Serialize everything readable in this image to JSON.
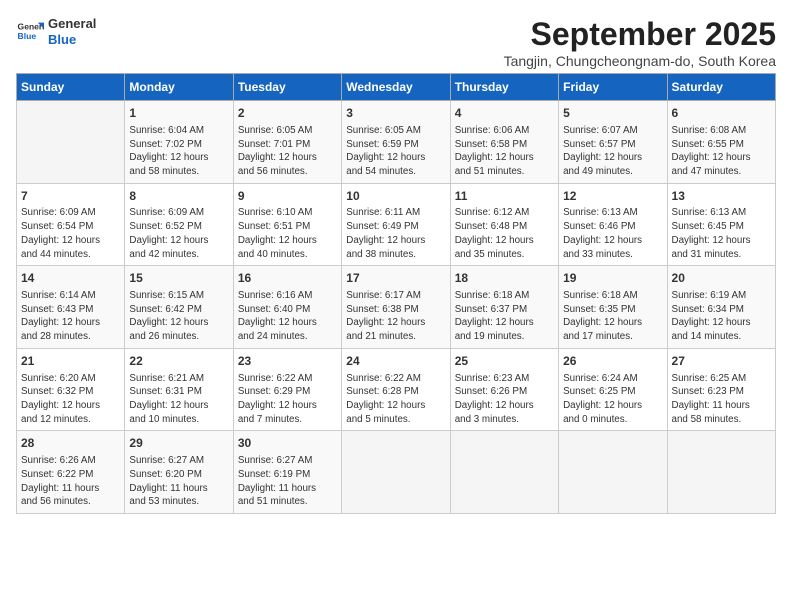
{
  "logo": {
    "line1": "General",
    "line2": "Blue"
  },
  "title": "September 2025",
  "location": "Tangjin, Chungcheongnam-do, South Korea",
  "weekdays": [
    "Sunday",
    "Monday",
    "Tuesday",
    "Wednesday",
    "Thursday",
    "Friday",
    "Saturday"
  ],
  "weeks": [
    [
      {
        "day": "",
        "text": ""
      },
      {
        "day": "1",
        "text": "Sunrise: 6:04 AM\nSunset: 7:02 PM\nDaylight: 12 hours\nand 58 minutes."
      },
      {
        "day": "2",
        "text": "Sunrise: 6:05 AM\nSunset: 7:01 PM\nDaylight: 12 hours\nand 56 minutes."
      },
      {
        "day": "3",
        "text": "Sunrise: 6:05 AM\nSunset: 6:59 PM\nDaylight: 12 hours\nand 54 minutes."
      },
      {
        "day": "4",
        "text": "Sunrise: 6:06 AM\nSunset: 6:58 PM\nDaylight: 12 hours\nand 51 minutes."
      },
      {
        "day": "5",
        "text": "Sunrise: 6:07 AM\nSunset: 6:57 PM\nDaylight: 12 hours\nand 49 minutes."
      },
      {
        "day": "6",
        "text": "Sunrise: 6:08 AM\nSunset: 6:55 PM\nDaylight: 12 hours\nand 47 minutes."
      }
    ],
    [
      {
        "day": "7",
        "text": "Sunrise: 6:09 AM\nSunset: 6:54 PM\nDaylight: 12 hours\nand 44 minutes."
      },
      {
        "day": "8",
        "text": "Sunrise: 6:09 AM\nSunset: 6:52 PM\nDaylight: 12 hours\nand 42 minutes."
      },
      {
        "day": "9",
        "text": "Sunrise: 6:10 AM\nSunset: 6:51 PM\nDaylight: 12 hours\nand 40 minutes."
      },
      {
        "day": "10",
        "text": "Sunrise: 6:11 AM\nSunset: 6:49 PM\nDaylight: 12 hours\nand 38 minutes."
      },
      {
        "day": "11",
        "text": "Sunrise: 6:12 AM\nSunset: 6:48 PM\nDaylight: 12 hours\nand 35 minutes."
      },
      {
        "day": "12",
        "text": "Sunrise: 6:13 AM\nSunset: 6:46 PM\nDaylight: 12 hours\nand 33 minutes."
      },
      {
        "day": "13",
        "text": "Sunrise: 6:13 AM\nSunset: 6:45 PM\nDaylight: 12 hours\nand 31 minutes."
      }
    ],
    [
      {
        "day": "14",
        "text": "Sunrise: 6:14 AM\nSunset: 6:43 PM\nDaylight: 12 hours\nand 28 minutes."
      },
      {
        "day": "15",
        "text": "Sunrise: 6:15 AM\nSunset: 6:42 PM\nDaylight: 12 hours\nand 26 minutes."
      },
      {
        "day": "16",
        "text": "Sunrise: 6:16 AM\nSunset: 6:40 PM\nDaylight: 12 hours\nand 24 minutes."
      },
      {
        "day": "17",
        "text": "Sunrise: 6:17 AM\nSunset: 6:38 PM\nDaylight: 12 hours\nand 21 minutes."
      },
      {
        "day": "18",
        "text": "Sunrise: 6:18 AM\nSunset: 6:37 PM\nDaylight: 12 hours\nand 19 minutes."
      },
      {
        "day": "19",
        "text": "Sunrise: 6:18 AM\nSunset: 6:35 PM\nDaylight: 12 hours\nand 17 minutes."
      },
      {
        "day": "20",
        "text": "Sunrise: 6:19 AM\nSunset: 6:34 PM\nDaylight: 12 hours\nand 14 minutes."
      }
    ],
    [
      {
        "day": "21",
        "text": "Sunrise: 6:20 AM\nSunset: 6:32 PM\nDaylight: 12 hours\nand 12 minutes."
      },
      {
        "day": "22",
        "text": "Sunrise: 6:21 AM\nSunset: 6:31 PM\nDaylight: 12 hours\nand 10 minutes."
      },
      {
        "day": "23",
        "text": "Sunrise: 6:22 AM\nSunset: 6:29 PM\nDaylight: 12 hours\nand 7 minutes."
      },
      {
        "day": "24",
        "text": "Sunrise: 6:22 AM\nSunset: 6:28 PM\nDaylight: 12 hours\nand 5 minutes."
      },
      {
        "day": "25",
        "text": "Sunrise: 6:23 AM\nSunset: 6:26 PM\nDaylight: 12 hours\nand 3 minutes."
      },
      {
        "day": "26",
        "text": "Sunrise: 6:24 AM\nSunset: 6:25 PM\nDaylight: 12 hours\nand 0 minutes."
      },
      {
        "day": "27",
        "text": "Sunrise: 6:25 AM\nSunset: 6:23 PM\nDaylight: 11 hours\nand 58 minutes."
      }
    ],
    [
      {
        "day": "28",
        "text": "Sunrise: 6:26 AM\nSunset: 6:22 PM\nDaylight: 11 hours\nand 56 minutes."
      },
      {
        "day": "29",
        "text": "Sunrise: 6:27 AM\nSunset: 6:20 PM\nDaylight: 11 hours\nand 53 minutes."
      },
      {
        "day": "30",
        "text": "Sunrise: 6:27 AM\nSunset: 6:19 PM\nDaylight: 11 hours\nand 51 minutes."
      },
      {
        "day": "",
        "text": ""
      },
      {
        "day": "",
        "text": ""
      },
      {
        "day": "",
        "text": ""
      },
      {
        "day": "",
        "text": ""
      }
    ]
  ]
}
